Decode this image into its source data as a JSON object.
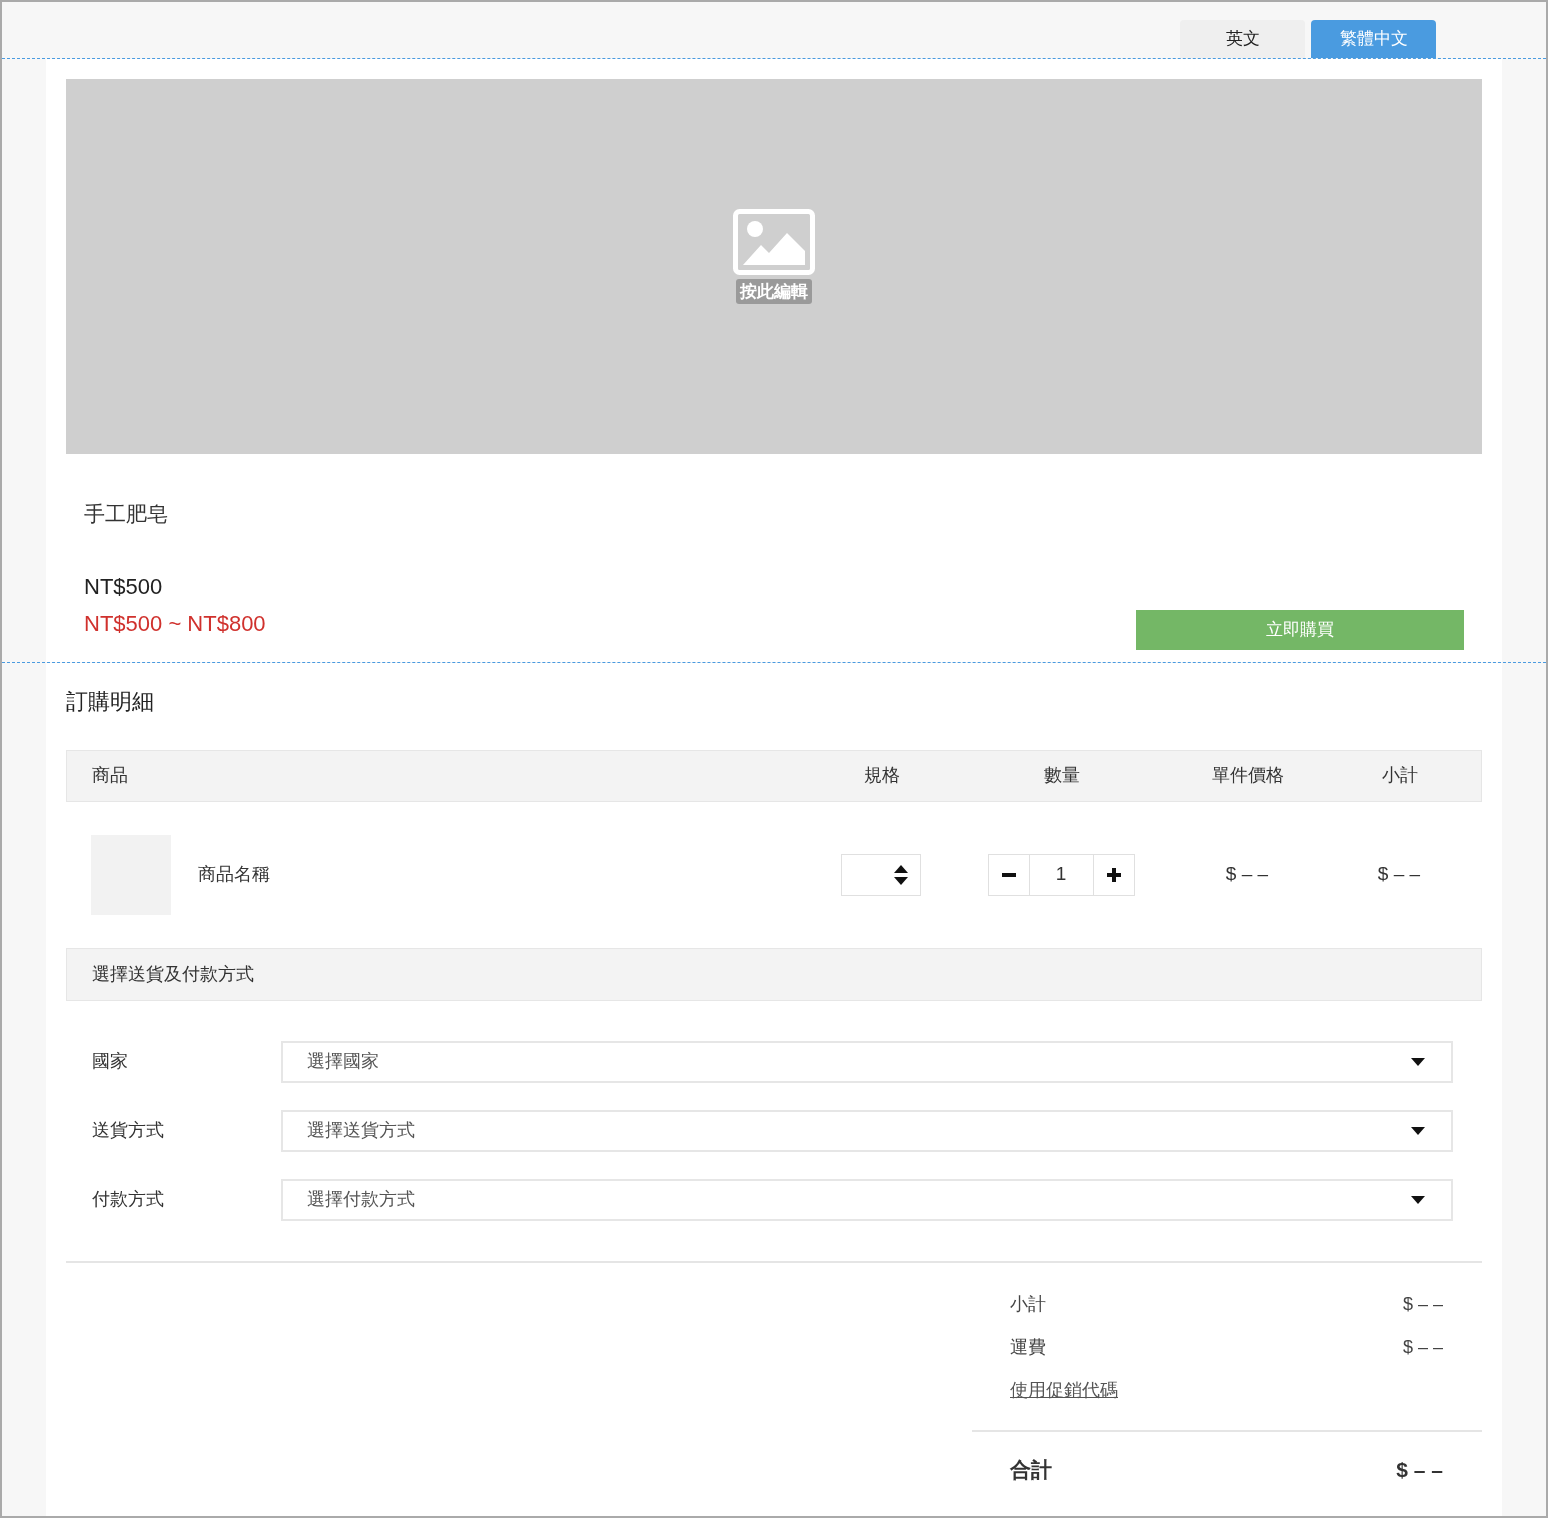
{
  "language_tabs": [
    {
      "label": "英文",
      "selected": false
    },
    {
      "label": "繁體中文",
      "selected": true
    }
  ],
  "product": {
    "image": {
      "caption": "按此編輯"
    },
    "name": "手工肥皂",
    "price": "NT$500",
    "price_range": "NT$500 ~ NT$800",
    "buy_button": "立即購買"
  },
  "order": {
    "title": "訂購明細",
    "columns": [
      "商品",
      "規格",
      "數量",
      "單件價格",
      "小計"
    ],
    "rows": [
      {
        "name": "商品名稱",
        "quantity": "1",
        "unit_price": "$ – –",
        "subtotal": "$ – –"
      }
    ],
    "shipping_title": "選擇送貨及付款方式",
    "fields": [
      {
        "label": "國家",
        "placeholder": "選擇國家"
      },
      {
        "label": "送貨方式",
        "placeholder": "選擇送貨方式"
      },
      {
        "label": "付款方式",
        "placeholder": "選擇付款方式"
      }
    ],
    "summary": [
      {
        "label": "小計",
        "value": "$ – –"
      },
      {
        "label": "運費",
        "value": "$ – –"
      }
    ],
    "promo_link": "使用促銷代碼",
    "total": {
      "label": "合計",
      "value": "$ – –"
    }
  }
}
